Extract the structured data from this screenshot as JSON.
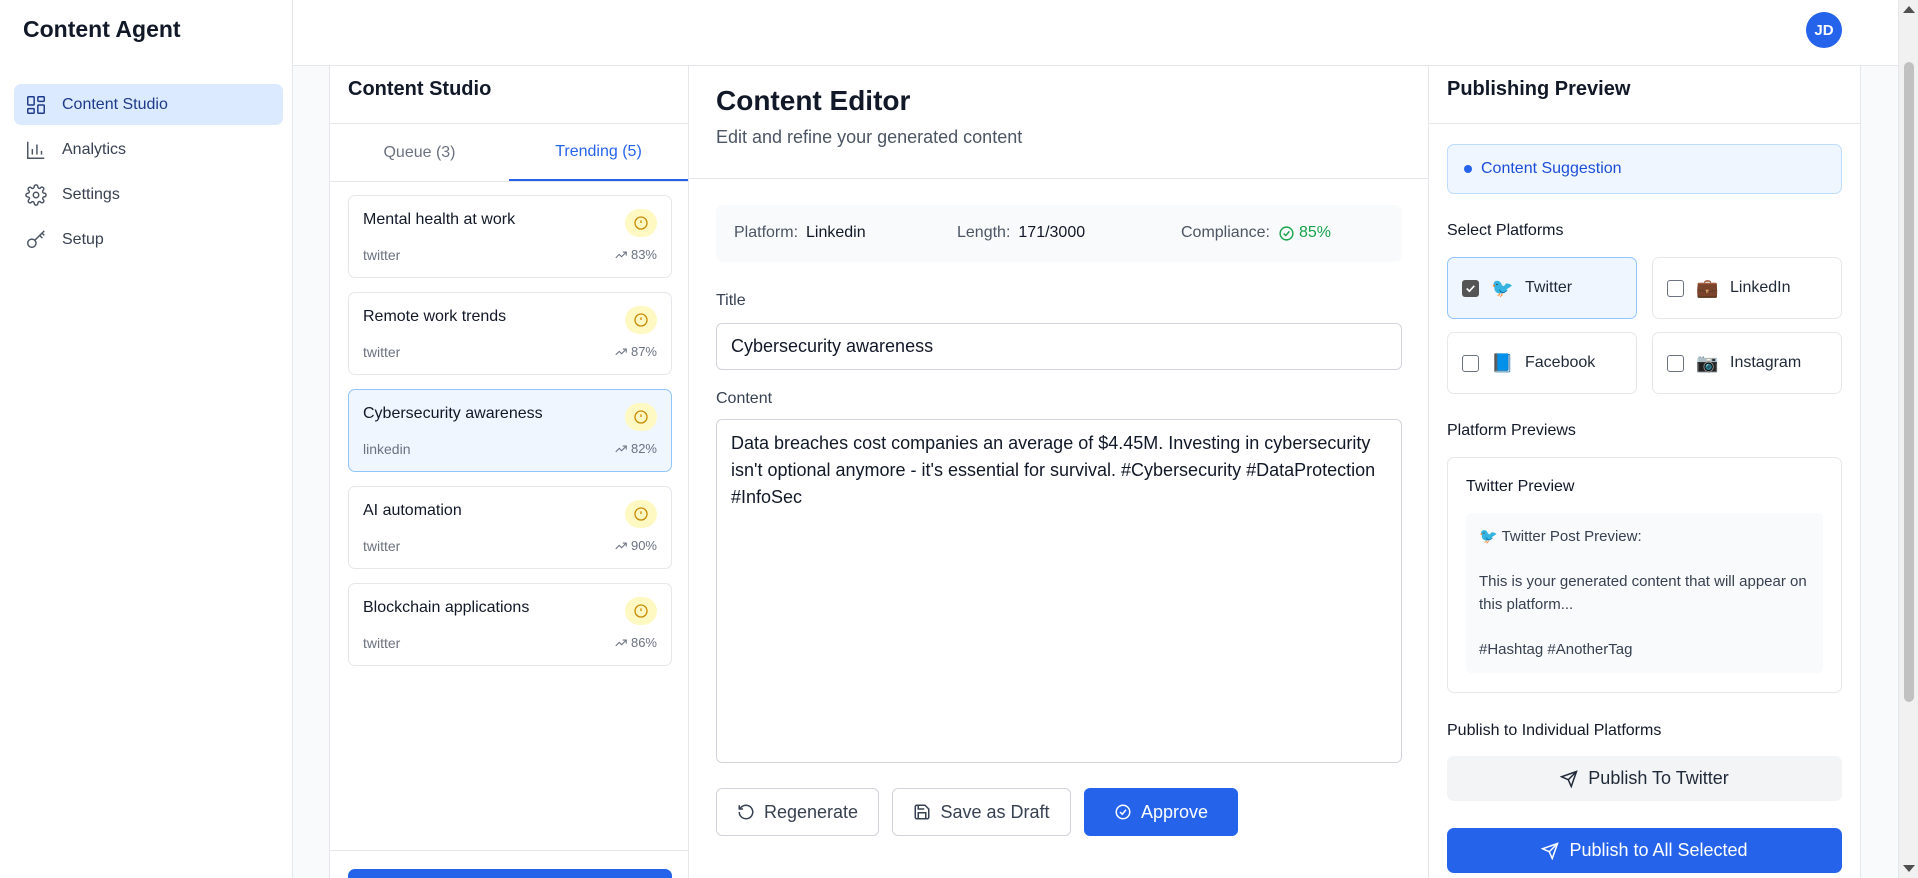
{
  "app": {
    "title": "Content Agent"
  },
  "sidebar": {
    "items": [
      {
        "label": "Content Studio",
        "icon": "dashboard-icon",
        "active": true
      },
      {
        "label": "Analytics",
        "icon": "bar-chart-icon",
        "active": false
      },
      {
        "label": "Settings",
        "icon": "gear-icon",
        "active": false
      },
      {
        "label": "Setup",
        "icon": "key-icon",
        "active": false
      }
    ]
  },
  "header": {
    "avatar_initials": "JD"
  },
  "studio": {
    "title": "Content Studio",
    "tabs": [
      {
        "label": "Queue (3)",
        "active": false
      },
      {
        "label": "Trending (5)",
        "active": true
      }
    ],
    "topics": [
      {
        "title": "Mental health at work",
        "platform": "twitter",
        "score": "83%"
      },
      {
        "title": "Remote work trends",
        "platform": "twitter",
        "score": "87%"
      },
      {
        "title": "Cybersecurity awareness",
        "platform": "linkedin",
        "score": "82%",
        "selected": true
      },
      {
        "title": "AI automation",
        "platform": "twitter",
        "score": "90%"
      },
      {
        "title": "Blockchain applications",
        "platform": "twitter",
        "score": "86%"
      }
    ]
  },
  "editor": {
    "title": "Content Editor",
    "subtitle": "Edit and refine your generated content",
    "meta": {
      "platform_label": "Platform:",
      "platform_value": "Linkedin",
      "length_label": "Length:",
      "length_value": "171/3000",
      "compliance_label": "Compliance:",
      "compliance_value": "85%"
    },
    "title_label": "Title",
    "title_value": "Cybersecurity awareness",
    "content_label": "Content",
    "content_value": "Data breaches cost companies an average of $4.45M. Investing in cybersecurity isn't optional anymore - it's essential for survival. #Cybersecurity #DataProtection #InfoSec",
    "buttons": {
      "regenerate": "Regenerate",
      "save_draft": "Save as Draft",
      "approve": "Approve"
    }
  },
  "publishing": {
    "title": "Publishing Preview",
    "suggestion": "Content Suggestion",
    "select_platforms_label": "Select Platforms",
    "platforms": [
      {
        "name": "Twitter",
        "emoji": "🐦",
        "checked": true
      },
      {
        "name": "LinkedIn",
        "emoji": "💼",
        "checked": false
      },
      {
        "name": "Facebook",
        "emoji": "📘",
        "checked": false
      },
      {
        "name": "Instagram",
        "emoji": "📷",
        "checked": false
      }
    ],
    "previews_label": "Platform Previews",
    "preview": {
      "title": "Twitter Preview",
      "heading": "🐦 Twitter Post Preview:",
      "body": "This is your generated content that will appear on this platform...",
      "hashtags": "#Hashtag #AnotherTag"
    },
    "individual_label": "Publish to Individual Platforms",
    "publish_twitter": "Publish To Twitter",
    "publish_all": "Publish to All Selected"
  },
  "colors": {
    "accent": "#2563eb",
    "active_nav_bg": "#dbeafe",
    "warning_bg": "#fef9c3",
    "success": "#16a34a"
  }
}
